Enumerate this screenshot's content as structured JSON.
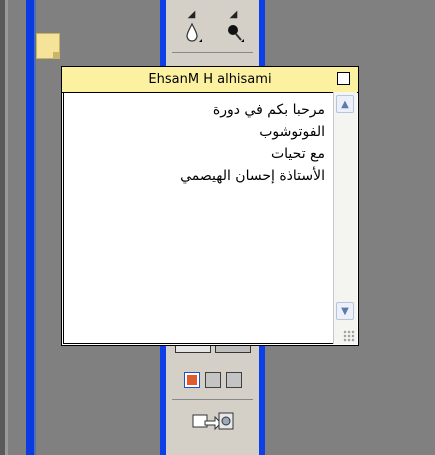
{
  "note": {
    "author": "EhsanM H alhisami",
    "lines": [
      "مرحبا بكم في دورة",
      "الفوتوشوب",
      "مع تحيات",
      "الأستاذة إحسان الهيصمي"
    ]
  },
  "icons": {
    "note": "note-annotation-icon",
    "close": "close-box-icon",
    "blur": "blur-drop-icon",
    "dodge": "dodge-icon",
    "scroll_up": "arrow-up-icon",
    "scroll_down": "arrow-down-icon",
    "quickmask": "quick-mask-mode-icon",
    "jump": "jump-to-imageready-icon"
  },
  "colors": {
    "toolbox_blue": "#0c3fe6",
    "note_yellow": "#fbf1a0",
    "background": "#808080"
  }
}
